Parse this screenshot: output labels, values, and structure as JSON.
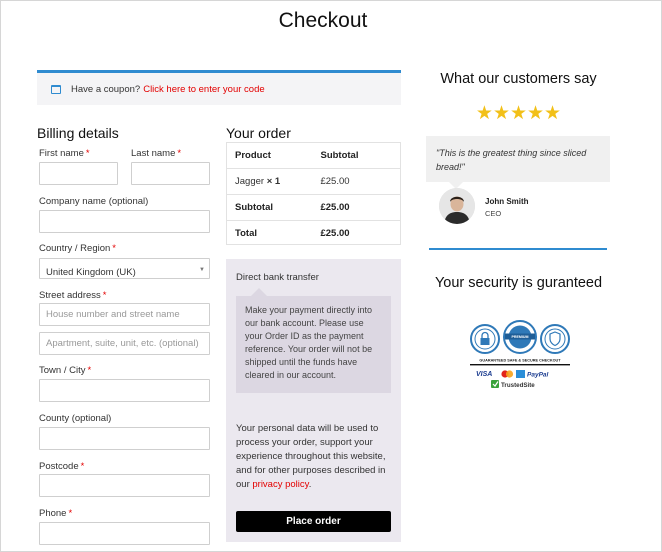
{
  "page": {
    "title": "Checkout"
  },
  "coupon": {
    "text": "Have a coupon?",
    "link": "Click here to enter your code"
  },
  "billing": {
    "title": "Billing details",
    "fields": {
      "first_name": {
        "label": "First name",
        "required": "*",
        "value": ""
      },
      "last_name": {
        "label": "Last name",
        "required": "*",
        "value": ""
      },
      "company": {
        "label": "Company name (optional)",
        "value": ""
      },
      "country": {
        "label": "Country / Region",
        "required": "*",
        "value": "United Kingdom (UK)"
      },
      "street": {
        "label": "Street address",
        "required": "*",
        "placeholder1": "House number and street name",
        "placeholder2": "Apartment, suite, unit, etc. (optional)"
      },
      "city": {
        "label": "Town / City",
        "required": "*",
        "value": ""
      },
      "county": {
        "label": "County (optional)",
        "value": ""
      },
      "postcode": {
        "label": "Postcode",
        "required": "*",
        "value": ""
      },
      "phone": {
        "label": "Phone",
        "required": "*",
        "value": ""
      }
    }
  },
  "order": {
    "title": "Your order",
    "header": {
      "product": "Product",
      "subtotal": "Subtotal"
    },
    "items": [
      {
        "name": "Jagger",
        "qty": "× 1",
        "price": "£25.00"
      }
    ],
    "subtotal": {
      "label": "Subtotal",
      "value": "£25.00"
    },
    "total": {
      "label": "Total",
      "value": "£25.00"
    }
  },
  "payment": {
    "method": "Direct bank transfer",
    "description": "Make your payment directly into our bank account. Please use your Order ID as the payment reference. Your order will not be shipped until the funds have cleared in our account.",
    "privacy_text": "Your personal data will be used to process your order, support your experience throughout this website, and for other purposes described in our",
    "privacy_link": "privacy policy",
    "privacy_end": ".",
    "place_order": "Place order"
  },
  "testimonial": {
    "heading": "What our customers say",
    "stars": "★★★★★",
    "quote": "\"This is the greatest thing since sliced bread!\"",
    "author": "John Smith",
    "role": "CEO"
  },
  "security": {
    "heading": "Your security is guranteed",
    "badge_banner": "GUARANTEED SAFE & SECURE CHECKOUT",
    "badge_premium": "PREMIUM",
    "payment_marks": {
      "visa": "VISA",
      "paypal": "PayPal",
      "trusted": "TrustedSite"
    }
  },
  "colors": {
    "accent": "#2f8bd0",
    "link": "#e30000",
    "star": "#f2c018",
    "button": "#000000"
  }
}
